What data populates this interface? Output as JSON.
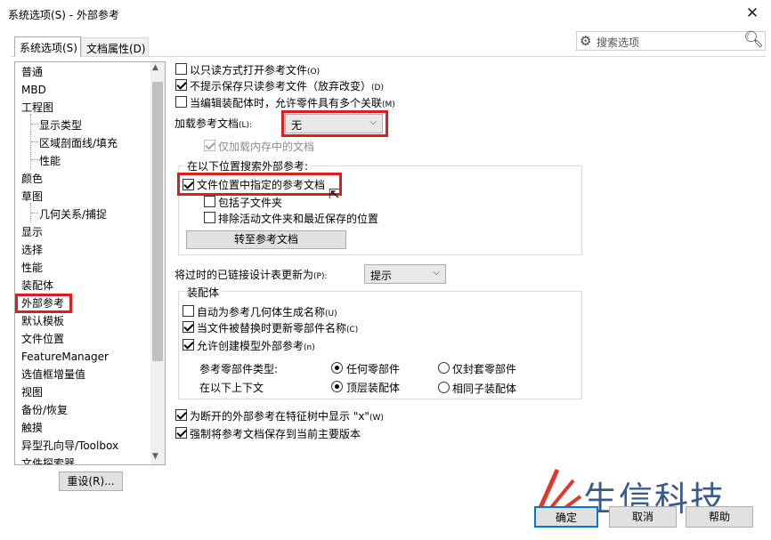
{
  "window": {
    "title": "系统选项(S) - 外部参考",
    "close_glyph": "✕"
  },
  "tabs": [
    {
      "label": "系统选项(S)"
    },
    {
      "label": "文档属性(D)"
    }
  ],
  "search": {
    "placeholder": "搜索选项"
  },
  "tree": {
    "items": [
      {
        "label": "普通",
        "level": 0
      },
      {
        "label": "MBD",
        "level": 0
      },
      {
        "label": "工程图",
        "level": 0
      },
      {
        "label": "显示类型",
        "level": 1
      },
      {
        "label": "区域剖面线/填充",
        "level": 1
      },
      {
        "label": "性能",
        "level": 1
      },
      {
        "label": "颜色",
        "level": 0
      },
      {
        "label": "草图",
        "level": 0
      },
      {
        "label": "几何关系/捕捉",
        "level": 1
      },
      {
        "label": "显示",
        "level": 0
      },
      {
        "label": "选择",
        "level": 0
      },
      {
        "label": "性能",
        "level": 0
      },
      {
        "label": "装配体",
        "level": 0
      },
      {
        "label": "外部参考",
        "level": 0,
        "selected": true
      },
      {
        "label": "默认模板",
        "level": 0
      },
      {
        "label": "文件位置",
        "level": 0
      },
      {
        "label": "FeatureManager",
        "level": 0
      },
      {
        "label": "选值框增量值",
        "level": 0
      },
      {
        "label": "视图",
        "level": 0
      },
      {
        "label": "备份/恢复",
        "level": 0
      },
      {
        "label": "触摸",
        "level": 0
      },
      {
        "label": "异型孔向导/Toolbox",
        "level": 0
      },
      {
        "label": "文件探索器",
        "level": 0
      }
    ]
  },
  "options": {
    "open_readonly": {
      "label": "以只读方式打开参考文件",
      "hotkey": "(O)",
      "checked": false
    },
    "no_prompt_save": {
      "label": "不提示保存只读参考文件（放弃改变）",
      "hotkey": "(D)",
      "checked": true
    },
    "allow_multi_ref": {
      "label": "当编辑装配体时，允许零件具有多个关联",
      "hotkey": "(M)",
      "checked": false
    },
    "load_ref_docs": {
      "label": "加载参考文档",
      "hotkey": "(L):",
      "value": "无"
    },
    "load_in_memory": {
      "label": "仅加载内存中的文档",
      "checked": true,
      "disabled": true
    },
    "search_group": {
      "title": "在以下位置搜索外部参考:",
      "file_location_docs": {
        "label": "文件位置中指定的参考文档",
        "checked": true
      },
      "include_subfolders": {
        "label": "包括子文件夹",
        "checked": false
      },
      "exclude_active": {
        "label": "排除活动文件夹和最近保存的位置",
        "checked": false
      },
      "goto_button": "转至参考文档"
    },
    "update_design_table": {
      "label": "将过时的已链接设计表更新为",
      "hotkey": "(P):",
      "value": "提示"
    },
    "assembly_group": {
      "title": "装配体",
      "auto_name": {
        "label": "自动为参考几何体生成名称",
        "hotkey": "(U)",
        "checked": false
      },
      "update_names": {
        "label": "当文件被替换时更新零部件名称",
        "hotkey": "(C)",
        "checked": true
      },
      "allow_create_ext": {
        "label": "允许创建模型外部参考",
        "hotkey": "(n)",
        "checked": true
      },
      "ref_component_type_label": "参考零部件类型:",
      "context_label": "在以下上下文",
      "radio_any_part": {
        "label": "任何零部件",
        "selected": true
      },
      "radio_closed_part": {
        "label": "仅封套零部件",
        "selected": false
      },
      "radio_top_assembly": {
        "label": "顶层装配体",
        "selected": true
      },
      "radio_same_sub": {
        "label": "相同子装配体",
        "selected": false
      }
    },
    "show_x_broken": {
      "label": "为断开的外部参考在特征树中显示 \"x\"",
      "hotkey": "(W)",
      "checked": true
    },
    "force_save_version": {
      "label": "强制将参考文档保存到当前主要版本",
      "checked": true
    }
  },
  "buttons": {
    "reset": "重设(R)...",
    "ok": "确定",
    "cancel": "取消",
    "help": "帮助"
  },
  "watermark": {
    "text": "生信科技"
  },
  "colors": {
    "highlight": "#e31b1b",
    "accent": "#0078d7",
    "watermark_red": "#d93a2b",
    "watermark_blue": "#3b5a8c"
  }
}
